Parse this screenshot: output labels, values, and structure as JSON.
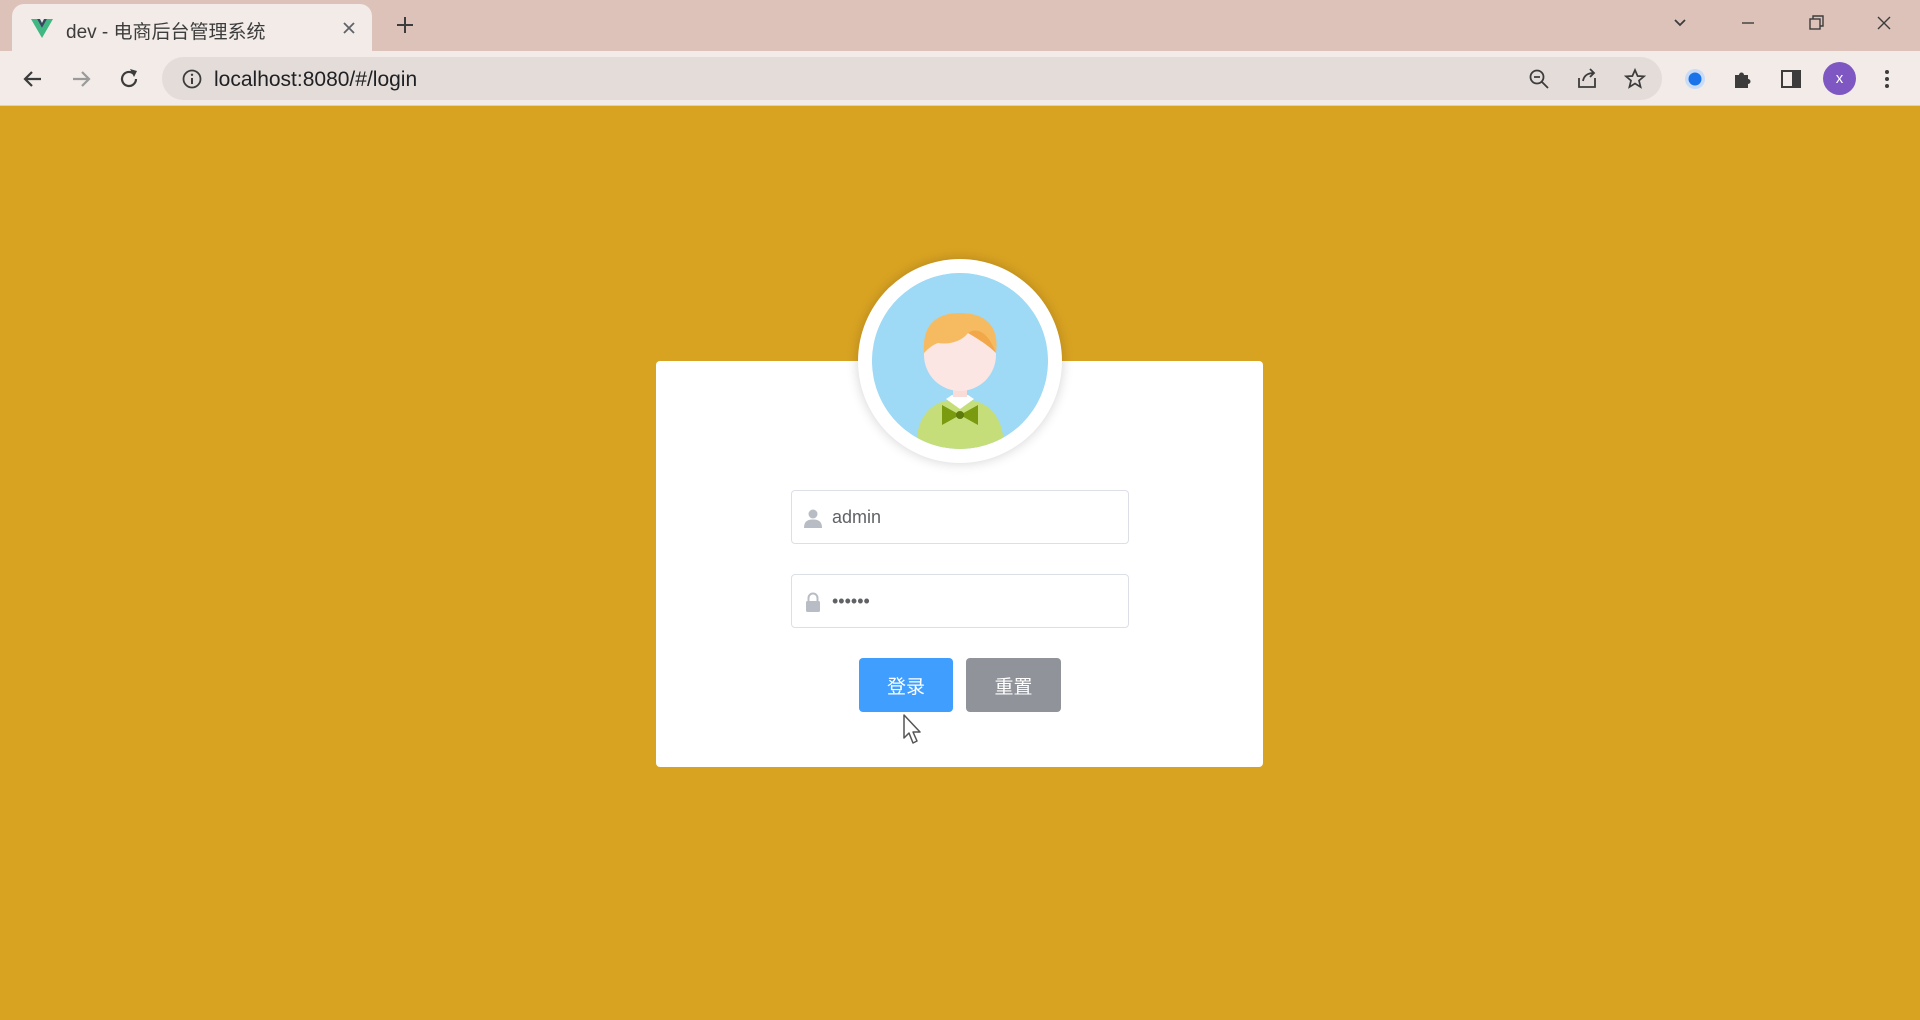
{
  "browser": {
    "tab_title": "dev - 电商后台管理系统",
    "url": "localhost:8080/#/login",
    "profile_initial": "x",
    "favicon": "vue-logo-icon"
  },
  "colors": {
    "page_background": "#d9a322",
    "primary": "#409eff",
    "info": "#909399"
  },
  "login": {
    "avatar": "user-avatar-illustration",
    "username": {
      "value": "admin",
      "icon": "user-icon"
    },
    "password": {
      "value": "••••••",
      "icon": "lock-icon"
    },
    "login_label": "登录",
    "reset_label": "重置"
  }
}
